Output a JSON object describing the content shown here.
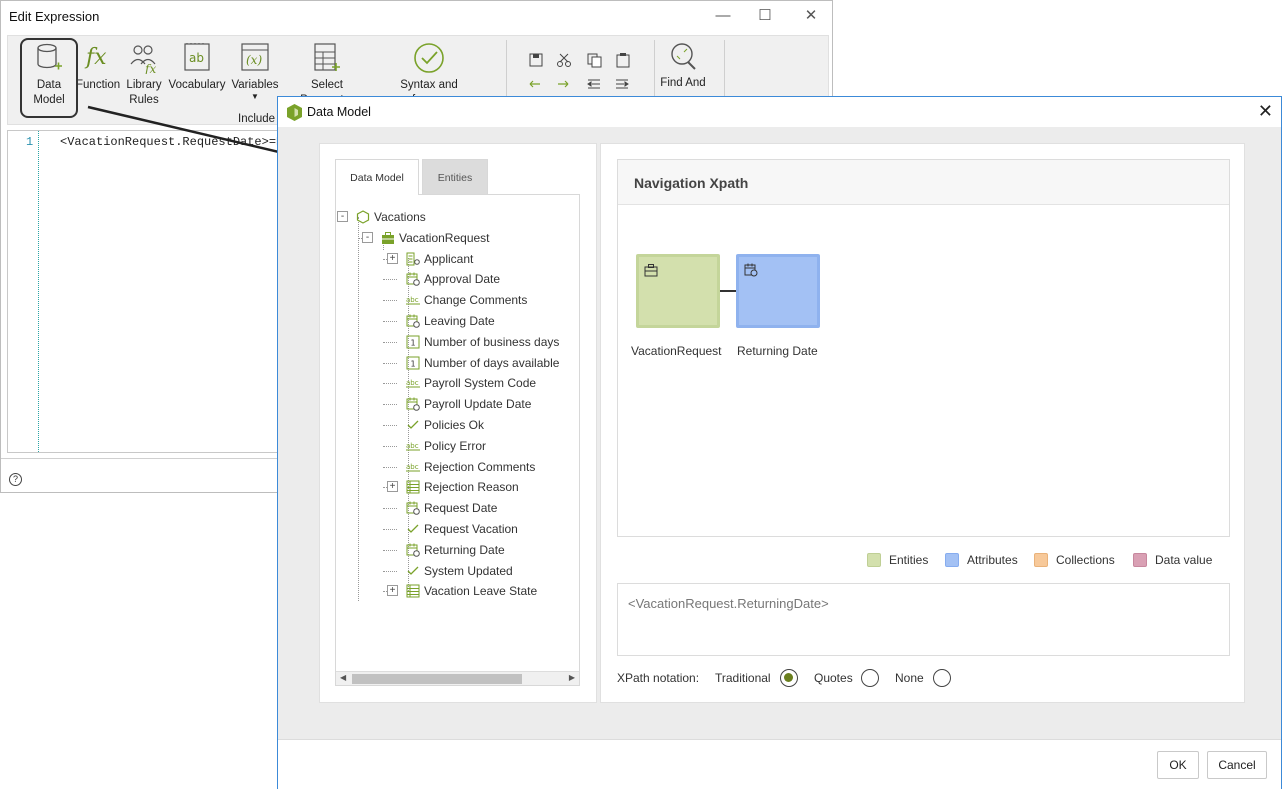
{
  "edit_expression": {
    "title": "Edit Expression",
    "ribbon": {
      "data_model": "Data\nModel",
      "function": "Function",
      "library_rules": "Library\nRules",
      "vocabulary": "Vocabulary",
      "variables": "Variables",
      "include": "Include",
      "select_parameter": "Select Parameter",
      "syntax": "Syntax and references",
      "find_and": "Find And"
    },
    "editor": {
      "line_number": "1",
      "code": "<VacationRequest.RequestDate>=Da"
    },
    "help": "?"
  },
  "data_model_dialog": {
    "title": "Data Model",
    "tabs": [
      "Data Model",
      "Entities"
    ],
    "tree": [
      {
        "label": "Vacations",
        "icon": "hexagon-icon",
        "expander": "-"
      },
      {
        "label": "VacationRequest",
        "icon": "briefcase-icon",
        "expander": "-"
      },
      {
        "label": "Applicant",
        "icon": "entity-link-icon",
        "expander": "+"
      },
      {
        "label": "Approval Date",
        "icon": "calendar-icon"
      },
      {
        "label": "Change Comments",
        "icon": "text-abc-icon"
      },
      {
        "label": "Leaving Date",
        "icon": "calendar-icon"
      },
      {
        "label": "Number of business days",
        "icon": "number-icon"
      },
      {
        "label": "Number of days available",
        "icon": "number-icon"
      },
      {
        "label": "Payroll System Code",
        "icon": "text-abc-icon"
      },
      {
        "label": "Payroll Update Date",
        "icon": "calendar-icon"
      },
      {
        "label": "Policies Ok",
        "icon": "check-icon"
      },
      {
        "label": "Policy Error",
        "icon": "text-abc-icon"
      },
      {
        "label": "Rejection Comments",
        "icon": "text-abc-icon"
      },
      {
        "label": "Rejection Reason",
        "icon": "list-icon",
        "expander": "+"
      },
      {
        "label": "Request Date",
        "icon": "calendar-icon"
      },
      {
        "label": "Request Vacation",
        "icon": "check-icon"
      },
      {
        "label": "Returning Date",
        "icon": "calendar-icon"
      },
      {
        "label": "System Updated",
        "icon": "check-icon"
      },
      {
        "label": "Vacation Leave State",
        "icon": "list-icon",
        "expander": "+"
      }
    ],
    "navigation": {
      "title": "Navigation Xpath",
      "nodes": [
        {
          "label": "VacationRequest",
          "type": "entity"
        },
        {
          "label": "Returning Date",
          "type": "attribute"
        }
      ]
    },
    "legend": [
      {
        "label": "Entities",
        "color": "#d3e0ad"
      },
      {
        "label": "Attributes",
        "color": "#a3c1f4"
      },
      {
        "label": "Collections",
        "color": "#f7c99a"
      },
      {
        "label": "Data value",
        "color": "#d9a0b4"
      }
    ],
    "xpath_value": "<VacationRequest.ReturningDate>",
    "notation": {
      "label": "XPath notation:",
      "options": [
        "Traditional",
        "Quotes",
        "None"
      ],
      "selected": "Traditional"
    },
    "buttons": {
      "ok": "OK",
      "cancel": "Cancel"
    }
  }
}
